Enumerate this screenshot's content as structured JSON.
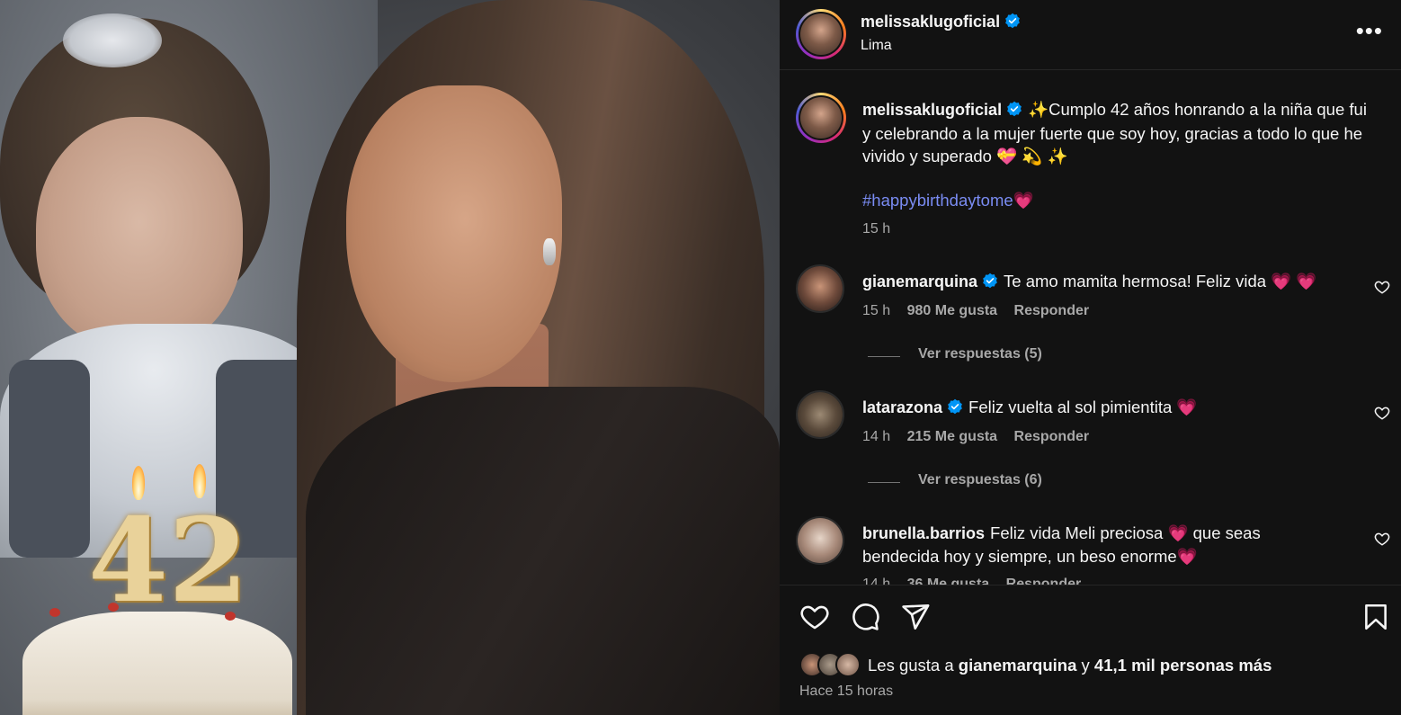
{
  "post": {
    "username": "melissaklugoficial",
    "location": "Lima",
    "more_label": "•••",
    "photo_digits": "42"
  },
  "caption": {
    "username": "melissaklugoficial",
    "text": "✨Cumplo 42 años honrando a la niña que fui y celebrando a la mujer fuerte que soy hoy, gracias a todo lo que he vivido y superado 💝 💫 ✨",
    "hashtag": "#happybirthdaytome",
    "hashtag_emoji": "💗",
    "time": "15 h"
  },
  "comments": [
    {
      "username": "gianemarquina",
      "verified": true,
      "text": "Te amo mamita hermosa! Feliz vida 💗 💗",
      "time": "15 h",
      "likes": "980 Me gusta",
      "reply_label": "Responder",
      "view_replies": "Ver respuestas (5)"
    },
    {
      "username": "latarazona",
      "verified": true,
      "text": "Feliz vuelta al sol pimientita 💗",
      "time": "14 h",
      "likes": "215 Me gusta",
      "reply_label": "Responder",
      "view_replies": "Ver respuestas (6)"
    },
    {
      "username": "brunella.barrios",
      "verified": false,
      "text": "Feliz vida Meli preciosa 💗 que seas bendecida hoy y siempre, un beso enorme💗",
      "time": "14 h",
      "likes": "36 Me gusta",
      "reply_label": "Responder"
    }
  ],
  "likes_summary": {
    "prefix": "Les gusta a ",
    "user": "gianemarquina",
    "joiner": " y ",
    "rest": "41,1 mil personas más"
  },
  "timestamp": "Hace 15 horas",
  "icons": {
    "like": "heart-icon",
    "comment": "comment-icon",
    "share": "share-icon",
    "save": "bookmark-icon",
    "verified": "verified-badge-icon",
    "more": "more-options-icon"
  },
  "colors": {
    "background": "#121212",
    "text": "#f5f5f5",
    "secondary": "#a8a8a8",
    "hashtag": "#7a8cf3",
    "verified": "#0095f6"
  }
}
